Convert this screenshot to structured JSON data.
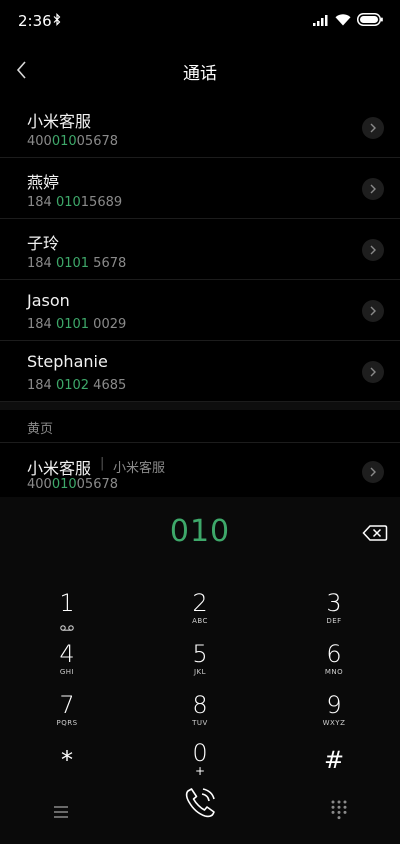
{
  "status_bar": {
    "time": "2:36"
  },
  "header": {
    "title": "通话"
  },
  "contacts": [
    {
      "name": "小米客服",
      "number_parts": [
        "400",
        "010",
        "05678"
      ]
    },
    {
      "name": "燕婷",
      "number_parts": [
        "184 ",
        "010",
        "15689"
      ]
    },
    {
      "name": "子玲",
      "number_parts": [
        "184 ",
        "0101",
        " 5678"
      ]
    },
    {
      "name": "Jason",
      "number_parts": [
        "184 ",
        "0101",
        " 0029"
      ]
    },
    {
      "name": "Stephanie",
      "number_parts": [
        "184 ",
        "0102",
        " 4685"
      ]
    }
  ],
  "yellow_pages": {
    "header": "黄页",
    "entry": {
      "name": "小米客服",
      "separator": "|",
      "category": "小米客服",
      "number_parts": [
        "400",
        "010",
        "05678"
      ]
    }
  },
  "dialer": {
    "input": "010",
    "keys": [
      {
        "digit": "1",
        "letters": ""
      },
      {
        "digit": "2",
        "letters": "ABC"
      },
      {
        "digit": "3",
        "letters": "DEF"
      },
      {
        "digit": "4",
        "letters": "GHI"
      },
      {
        "digit": "5",
        "letters": "JKL"
      },
      {
        "digit": "6",
        "letters": "MNO"
      },
      {
        "digit": "7",
        "letters": "PQRS"
      },
      {
        "digit": "8",
        "letters": "TUV"
      },
      {
        "digit": "9",
        "letters": "WXYZ"
      },
      {
        "digit": "*",
        "letters": ""
      },
      {
        "digit": "0",
        "letters": "+"
      },
      {
        "digit": "#",
        "letters": ""
      }
    ]
  },
  "colors": {
    "match_highlight": "#3ea86a",
    "background": "#000000"
  },
  "icons": [
    "bluetooth-icon",
    "signal-icon",
    "wifi-icon",
    "battery-icon",
    "back-icon",
    "chevron-right-icon",
    "backspace-icon",
    "voicemail-icon",
    "menu-icon",
    "phone-call-icon",
    "keypad-icon"
  ]
}
